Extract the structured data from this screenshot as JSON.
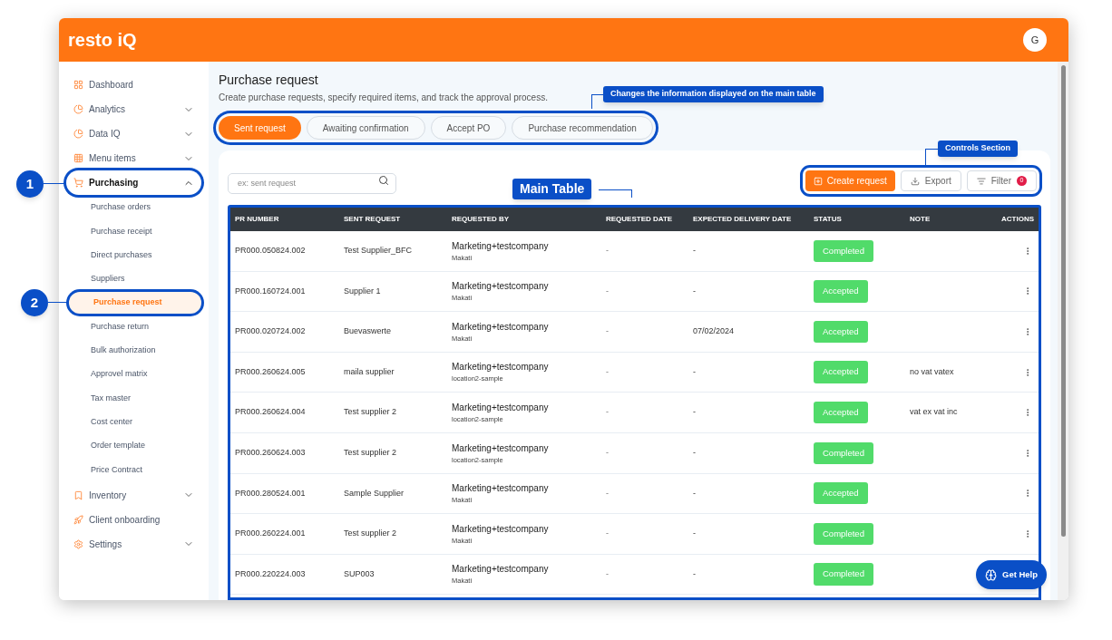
{
  "header": {
    "logo": "resto iQ",
    "avatar": "G"
  },
  "sidebar": {
    "items": [
      {
        "label": "Dashboard",
        "kind": "link"
      },
      {
        "label": "Analytics",
        "kind": "group",
        "expanded": false
      },
      {
        "label": "Data IQ",
        "kind": "group",
        "expanded": false
      },
      {
        "label": "Menu items",
        "kind": "group",
        "expanded": false
      },
      {
        "label": "Purchasing",
        "kind": "group",
        "expanded": true,
        "children": [
          {
            "label": "Purchase orders",
            "selected": false
          },
          {
            "label": "Purchase receipt",
            "selected": false
          },
          {
            "label": "Direct purchases",
            "selected": false
          },
          {
            "label": "Suppliers",
            "selected": false
          },
          {
            "label": "Purchase request",
            "selected": true
          },
          {
            "label": "Purchase return",
            "selected": false
          },
          {
            "label": "Bulk authorization",
            "selected": false
          },
          {
            "label": "Approvel matrix",
            "selected": false
          },
          {
            "label": "Tax master",
            "selected": false
          },
          {
            "label": "Cost center",
            "selected": false
          },
          {
            "label": "Order template",
            "selected": false
          },
          {
            "label": "Price Contract",
            "selected": false
          }
        ]
      },
      {
        "label": "Inventory",
        "kind": "group",
        "expanded": false
      },
      {
        "label": "Client onboarding",
        "kind": "link"
      },
      {
        "label": "Settings",
        "kind": "group",
        "expanded": false
      }
    ]
  },
  "page": {
    "title": "Purchase request",
    "subtitle": "Create purchase requests, specify required items, and track the approval process.",
    "tabs": [
      {
        "label": "Sent request",
        "selected": true
      },
      {
        "label": "Awaiting confirmation",
        "selected": false
      },
      {
        "label": "Accept PO",
        "selected": false
      },
      {
        "label": "Purchase recommendation",
        "selected": false
      }
    ],
    "search": {
      "placeholder": "ex: sent request"
    },
    "buttons": {
      "create": "Create request",
      "export": "Export",
      "filter": "Filter",
      "filter_count": "0"
    }
  },
  "table": {
    "columns": [
      "PR NUMBER",
      "SENT REQUEST",
      "REQUESTED BY",
      "REQUESTED DATE",
      "EXPECTED DELIVERY DATE",
      "STATUS",
      "NOTE",
      "ACTIONS"
    ],
    "rows": [
      {
        "pr_number": "PR000.050824.002",
        "sent_request": "Test Supplier_BFC",
        "requested_by": "Marketing+testcompany",
        "location": "Makati",
        "requested_date": "-",
        "expected_delivery_date": "-",
        "status": "Completed"
      },
      {
        "pr_number": "PR000.160724.001",
        "sent_request": "Supplier 1",
        "requested_by": "Marketing+testcompany",
        "location": "Makati",
        "requested_date": "-",
        "expected_delivery_date": "-",
        "status": "Accepted"
      },
      {
        "pr_number": "PR000.020724.002",
        "sent_request": "Buevaswerte",
        "requested_by": "Marketing+testcompany",
        "location": "Makati",
        "requested_date": "-",
        "expected_delivery_date": "07/02/2024",
        "status": "Accepted"
      },
      {
        "pr_number": "PR000.260624.005",
        "sent_request": "maila supplier",
        "requested_by": "Marketing+testcompany",
        "location": "location2-sample",
        "requested_date": "-",
        "expected_delivery_date": "-",
        "status": "Accepted",
        "note": "no vat vatex"
      },
      {
        "pr_number": "PR000.260624.004",
        "sent_request": "Test supplier 2",
        "requested_by": "Marketing+testcompany",
        "location": "location2-sample",
        "requested_date": "-",
        "expected_delivery_date": "-",
        "status": "Accepted",
        "note": "vat ex vat inc"
      },
      {
        "pr_number": "PR000.260624.003",
        "sent_request": "Test supplier 2",
        "requested_by": "Marketing+testcompany",
        "location": "location2-sample",
        "requested_date": "-",
        "expected_delivery_date": "-",
        "status": "Completed"
      },
      {
        "pr_number": "PR000.280524.001",
        "sent_request": "Sample Supplier",
        "requested_by": "Marketing+testcompany",
        "location": "Makati",
        "requested_date": "-",
        "expected_delivery_date": "-",
        "status": "Accepted"
      },
      {
        "pr_number": "PR000.260224.001",
        "sent_request": "Test supplier 2",
        "requested_by": "Marketing+testcompany",
        "location": "Makati",
        "requested_date": "-",
        "expected_delivery_date": "-",
        "status": "Completed"
      },
      {
        "pr_number": "PR000.220224.003",
        "sent_request": "SUP003",
        "requested_by": "Marketing+testcompany",
        "location": "Makati",
        "requested_date": "-",
        "expected_delivery_date": "-",
        "status": "Completed"
      }
    ]
  },
  "help_button": "Get Help",
  "annotations": [
    {
      "kind": "number",
      "text": "1"
    },
    {
      "kind": "number",
      "text": "2"
    },
    {
      "kind": "label",
      "text": "Changes the information displayed on the main table"
    },
    {
      "kind": "label",
      "text": "Controls Section"
    },
    {
      "kind": "title",
      "text": "Main Table"
    }
  ]
}
